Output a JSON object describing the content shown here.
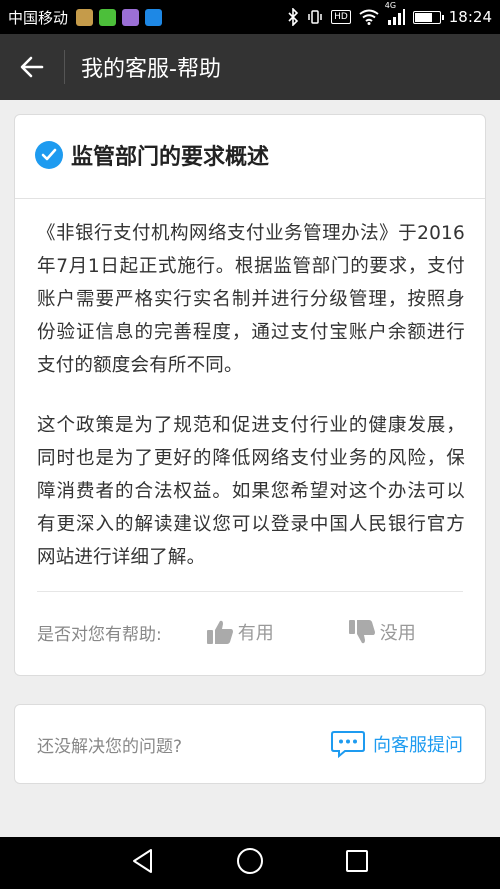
{
  "status_bar": {
    "carrier": "中国移动",
    "network": "4G",
    "time": "18:24",
    "battery_level": 0.65,
    "app_icons": [
      {
        "name": "app-icon-1",
        "color": "#c59b4a"
      },
      {
        "name": "wechat-icon",
        "color": "#4cbf3a"
      },
      {
        "name": "app-icon-3",
        "color": "#9b6fd6"
      },
      {
        "name": "alipay-icon",
        "color": "#1e88e5"
      }
    ]
  },
  "header": {
    "title": "我的客服-帮助"
  },
  "article": {
    "title": "监管部门的要求概述",
    "paragraphs": [
      "《非银行支付机构网络支付业务管理办法》于2016年7月1日起正式施行。根据监管部门的要求，支付账户需要严格实行实名制并进行分级管理，按照身份验证信息的完善程度，通过支付宝账户余额进行支付的额度会有所不同。",
      "这个政策是为了规范和促进支付行业的健康发展，同时也是为了更好的降低网络支付业务的风险，保障消费者的合法权益。如果您希望对这个办法可以有更深入的解读建议您可以登录中国人民银行官方网站进行详细了解。"
    ]
  },
  "feedback": {
    "label": "是否对您有帮助:",
    "useful": "有用",
    "useless": "没用"
  },
  "unresolved": {
    "text": "还没解决您的问题?",
    "ask_label": "向客服提问"
  },
  "colors": {
    "accent": "#1e9bf0",
    "header_bg": "#333333"
  }
}
